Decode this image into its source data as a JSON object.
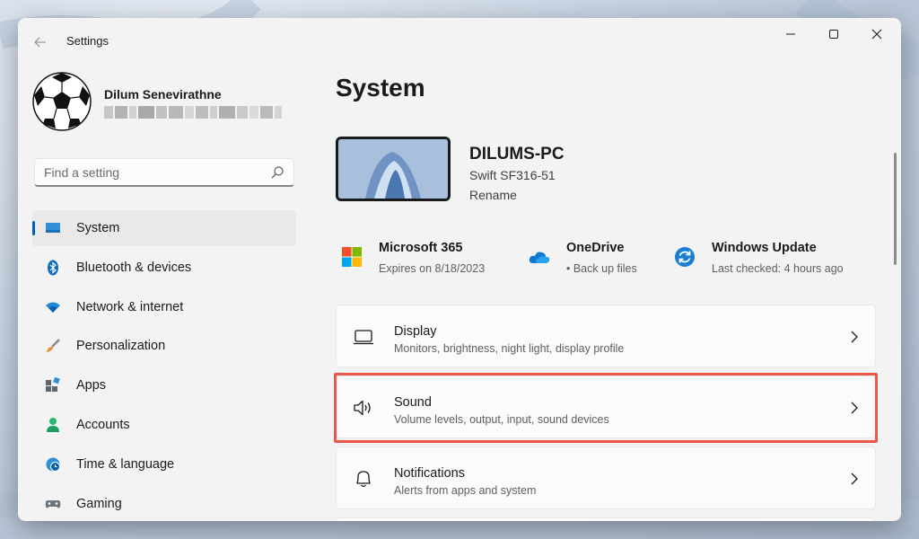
{
  "window": {
    "title": "Settings"
  },
  "user": {
    "name": "Dilum Senevirathne"
  },
  "search": {
    "placeholder": "Find a setting"
  },
  "sidebar": {
    "items": [
      {
        "label": "System",
        "icon": "system-monitor-icon",
        "active": true
      },
      {
        "label": "Bluetooth & devices",
        "icon": "bluetooth-icon"
      },
      {
        "label": "Network & internet",
        "icon": "wifi-icon"
      },
      {
        "label": "Personalization",
        "icon": "brush-icon"
      },
      {
        "label": "Apps",
        "icon": "apps-icon"
      },
      {
        "label": "Accounts",
        "icon": "person-icon"
      },
      {
        "label": "Time & language",
        "icon": "globe-clock-icon"
      },
      {
        "label": "Gaming",
        "icon": "gamepad-icon"
      }
    ]
  },
  "main": {
    "title": "System",
    "device": {
      "name": "DILUMS-PC",
      "model": "Swift SF316-51",
      "rename": "Rename"
    },
    "quick": [
      {
        "title": "Microsoft 365",
        "subtitle": "Expires on 8/18/2023",
        "icon": "microsoft-logo-icon"
      },
      {
        "title": "OneDrive",
        "subtitle": "• Back up files",
        "icon": "onedrive-cloud-icon"
      },
      {
        "title": "Windows Update",
        "subtitle": "Last checked: 4 hours ago",
        "icon": "windows-update-icon"
      }
    ],
    "cards": [
      {
        "title": "Display",
        "subtitle": "Monitors, brightness, night light, display profile",
        "icon": "display-icon"
      },
      {
        "title": "Sound",
        "subtitle": "Volume levels, output, input, sound devices",
        "icon": "speaker-icon",
        "highlighted": true
      },
      {
        "title": "Notifications",
        "subtitle": "Alerts from apps and system",
        "icon": "bell-icon"
      }
    ]
  },
  "colors": {
    "accent": "#005fb8",
    "highlight": "#e8574a",
    "window_bg": "#f3f3f3",
    "card_bg": "#fbfbfb"
  }
}
